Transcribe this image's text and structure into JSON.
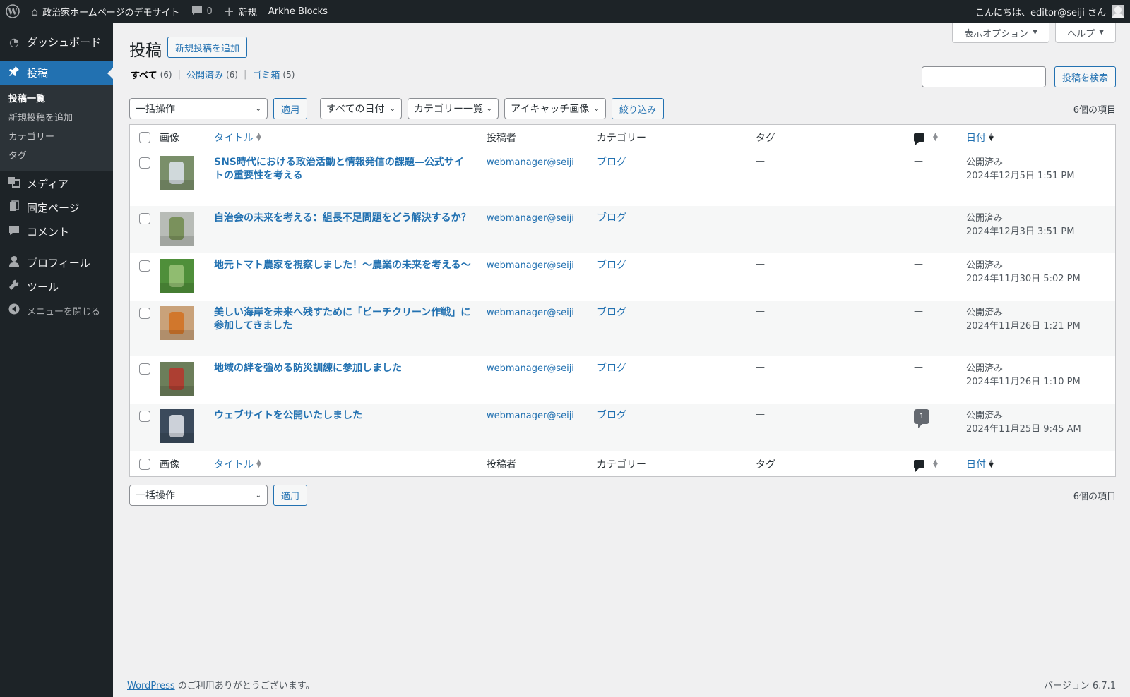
{
  "adminbar": {
    "site_name": "政治家ホームページのデモサイト",
    "comments_count": "0",
    "new_label": "新規",
    "theme_label": "Arkhe Blocks",
    "greeting": "こんにちは、editor@seiji さん"
  },
  "sidebar": {
    "dashboard": "ダッシュボード",
    "posts": "投稿",
    "sub": [
      "投稿一覧",
      "新規投稿を追加",
      "カテゴリー",
      "タグ"
    ],
    "media": "メディア",
    "pages": "固定ページ",
    "comments": "コメント",
    "profile": "プロフィール",
    "tools": "ツール",
    "collapse": "メニューを閉じる"
  },
  "screen_meta": {
    "options": "表示オプション",
    "help": "ヘルプ"
  },
  "page": {
    "title": "投稿",
    "add_new": "新規投稿を追加"
  },
  "filters_status": {
    "all": "すべて",
    "all_count": "(6)",
    "published": "公開済み",
    "published_count": "(6)",
    "trash": "ゴミ箱",
    "trash_count": "(5)"
  },
  "search": {
    "button": "投稿を検索"
  },
  "tablenav": {
    "bulk": "一括操作",
    "apply": "適用",
    "dates": "すべての日付",
    "category": "カテゴリー一覧",
    "eyecatch": "アイキャッチ画像",
    "filter": "絞り込み",
    "items": "6個の項目"
  },
  "columns": {
    "image": "画像",
    "title": "タイトル",
    "author": "投稿者",
    "category": "カテゴリー",
    "tags": "タグ",
    "date": "日付"
  },
  "posts": [
    {
      "title": "SNS時代における政治活動と情報発信の課題—公式サイトの重要性を考える",
      "author": "webmanager@seiji",
      "category": "ブログ",
      "tags": "—",
      "comments": "—",
      "status": "公開済み",
      "date": "2024年12月5日 1:51 PM",
      "thumb_color": "#7a8f6a",
      "thumb_accent": "#dfe6ee"
    },
    {
      "title": "自治会の未来を考える：組長不足問題をどう解決するか？",
      "author": "webmanager@seiji",
      "category": "ブログ",
      "tags": "—",
      "comments": "—",
      "status": "公開済み",
      "date": "2024年12月3日 3:51 PM",
      "thumb_color": "#b8bcb7",
      "thumb_accent": "#6f8a4c"
    },
    {
      "title": "地元トマト農家を視察しました！～農業の未来を考える～",
      "author": "webmanager@seiji",
      "category": "ブログ",
      "tags": "—",
      "comments": "—",
      "status": "公開済み",
      "date": "2024年11月30日 5:02 PM",
      "thumb_color": "#4f8f3a",
      "thumb_accent": "#9bc47a"
    },
    {
      "title": "美しい海岸を未来へ残すために「ビーチクリーン作戦」に参加してきました",
      "author": "webmanager@seiji",
      "category": "ブログ",
      "tags": "—",
      "comments": "—",
      "status": "公開済み",
      "date": "2024年11月26日 1:21 PM",
      "thumb_color": "#c9a27a",
      "thumb_accent": "#d2701f"
    },
    {
      "title": "地域の絆を強める防災訓練に参加しました",
      "author": "webmanager@seiji",
      "category": "ブログ",
      "tags": "—",
      "comments": "—",
      "status": "公開済み",
      "date": "2024年11月26日 1:10 PM",
      "thumb_color": "#6c7e5a",
      "thumb_accent": "#b8342c"
    },
    {
      "title": "ウェブサイトを公開いたしました",
      "author": "webmanager@seiji",
      "category": "ブログ",
      "tags": "—",
      "comments": "1",
      "status": "公開済み",
      "date": "2024年11月25日 9:45 AM",
      "thumb_color": "#3b4a5c",
      "thumb_accent": "#e6e9ee"
    }
  ],
  "footer": {
    "wp_link": "WordPress",
    "thanks": " のご利用ありがとうございます。",
    "version": "バージョン 6.7.1"
  }
}
